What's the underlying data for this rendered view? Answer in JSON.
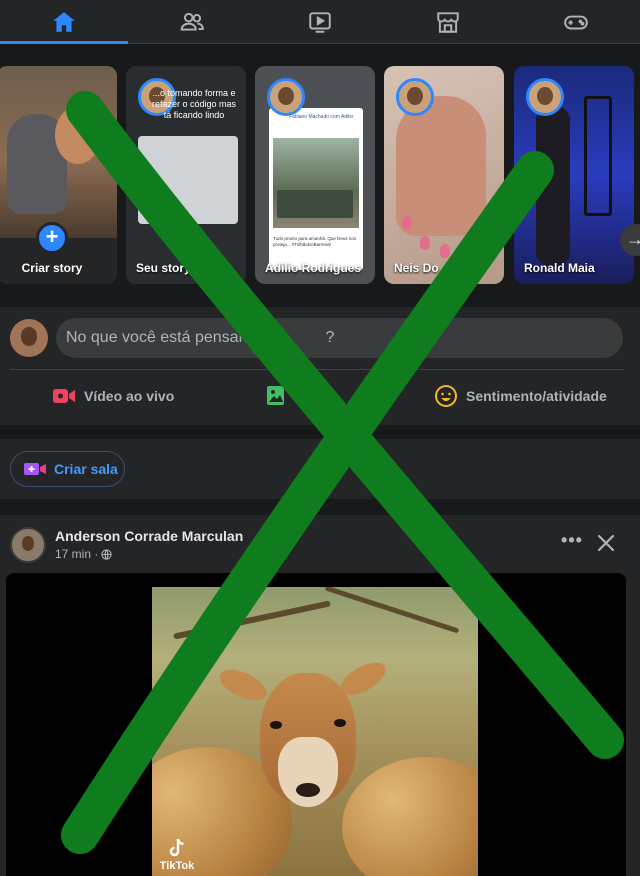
{
  "nav": {
    "tabs": [
      {
        "name": "home",
        "icon": "home-icon",
        "active": true
      },
      {
        "name": "friends",
        "icon": "friends-icon",
        "active": false
      },
      {
        "name": "watch",
        "icon": "video-icon",
        "active": false
      },
      {
        "name": "marketplace",
        "icon": "marketplace-icon",
        "active": false
      },
      {
        "name": "gaming",
        "icon": "gamepad-icon",
        "active": false
      }
    ],
    "accent_color": "#2d88ff"
  },
  "stories": {
    "create_label": "Criar story",
    "items": [
      {
        "label": "Seu story",
        "overlay_text": "...o tomando forma e refazer o código mas tá ficando lindo"
      },
      {
        "label": "Adilio Rodrigues",
        "shared_author": "Fabiano Machado com Adilio",
        "shared_text": "Tudo pronto para amanhã. Que Deus nos proteja... #TrilhãoDoBarrenal"
      },
      {
        "label": "Neis Do",
        "icon": "avatar"
      },
      {
        "label": "Ronald Maia"
      }
    ]
  },
  "composer": {
    "placeholder": "No que você está pensando?",
    "visible_text": "No que você está pensan",
    "suffix": "?",
    "live_video": "Vídeo ao vivo",
    "photo": "Foto",
    "feeling": "Sentimento/atividade",
    "live_color": "#f3425f",
    "photo_color": "#45bd62",
    "feeling_color": "#f7b928"
  },
  "room": {
    "create_room": "Criar sala"
  },
  "post": {
    "author": "Anderson Corrade Marculan",
    "time": "17 min",
    "privacy_icon": "globe-icon",
    "more_label": "•••",
    "watermark": "TikTok"
  },
  "overlay": {
    "mark": "X",
    "color": "#0f7d1e"
  }
}
